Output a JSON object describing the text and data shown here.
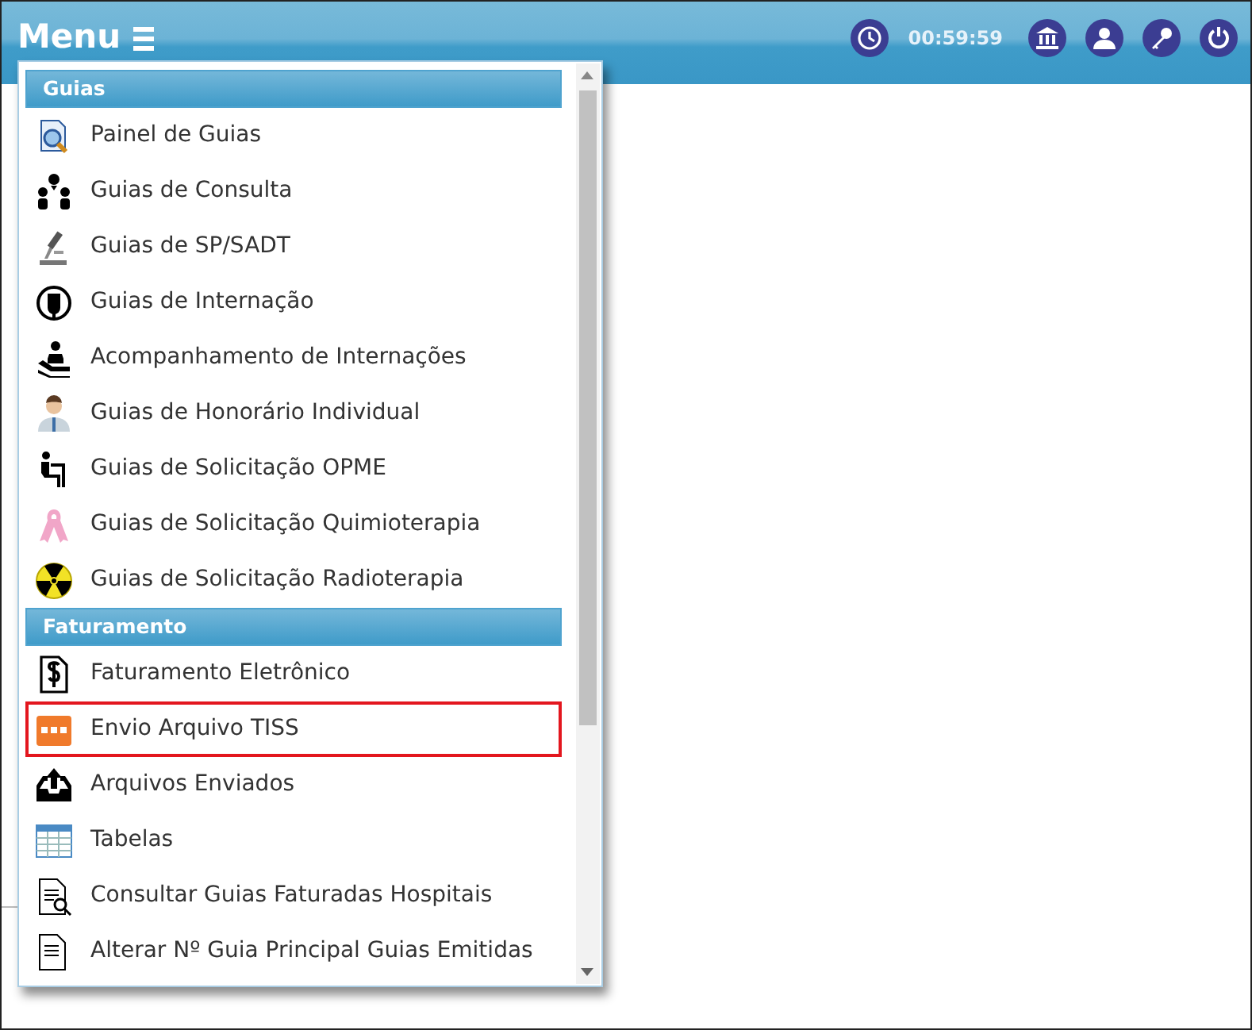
{
  "header": {
    "menu_label": "Menu",
    "time": "00:59:59"
  },
  "menu": {
    "sections": [
      {
        "title": "Guias",
        "items": [
          {
            "label": "Painel de Guias",
            "highlighted": false
          },
          {
            "label": "Guias de Consulta",
            "highlighted": false
          },
          {
            "label": "Guias de SP/SADT",
            "highlighted": false
          },
          {
            "label": "Guias de Internação",
            "highlighted": false
          },
          {
            "label": "Acompanhamento de Internações",
            "highlighted": false
          },
          {
            "label": "Guias de Honorário Individual",
            "highlighted": false
          },
          {
            "label": "Guias de Solicitação OPME",
            "highlighted": false
          },
          {
            "label": "Guias de Solicitação Quimioterapia",
            "highlighted": false
          },
          {
            "label": "Guias de Solicitação Radioterapia",
            "highlighted": false
          }
        ]
      },
      {
        "title": "Faturamento",
        "items": [
          {
            "label": "Faturamento Eletrônico",
            "highlighted": false
          },
          {
            "label": "Envio Arquivo TISS",
            "highlighted": true
          },
          {
            "label": "Arquivos Enviados",
            "highlighted": false
          },
          {
            "label": "Tabelas",
            "highlighted": false
          },
          {
            "label": "Consultar Guias Faturadas Hospitais",
            "highlighted": false
          },
          {
            "label": "Alterar Nº Guia Principal Guias Emitidas",
            "highlighted": false
          }
        ]
      }
    ]
  }
}
